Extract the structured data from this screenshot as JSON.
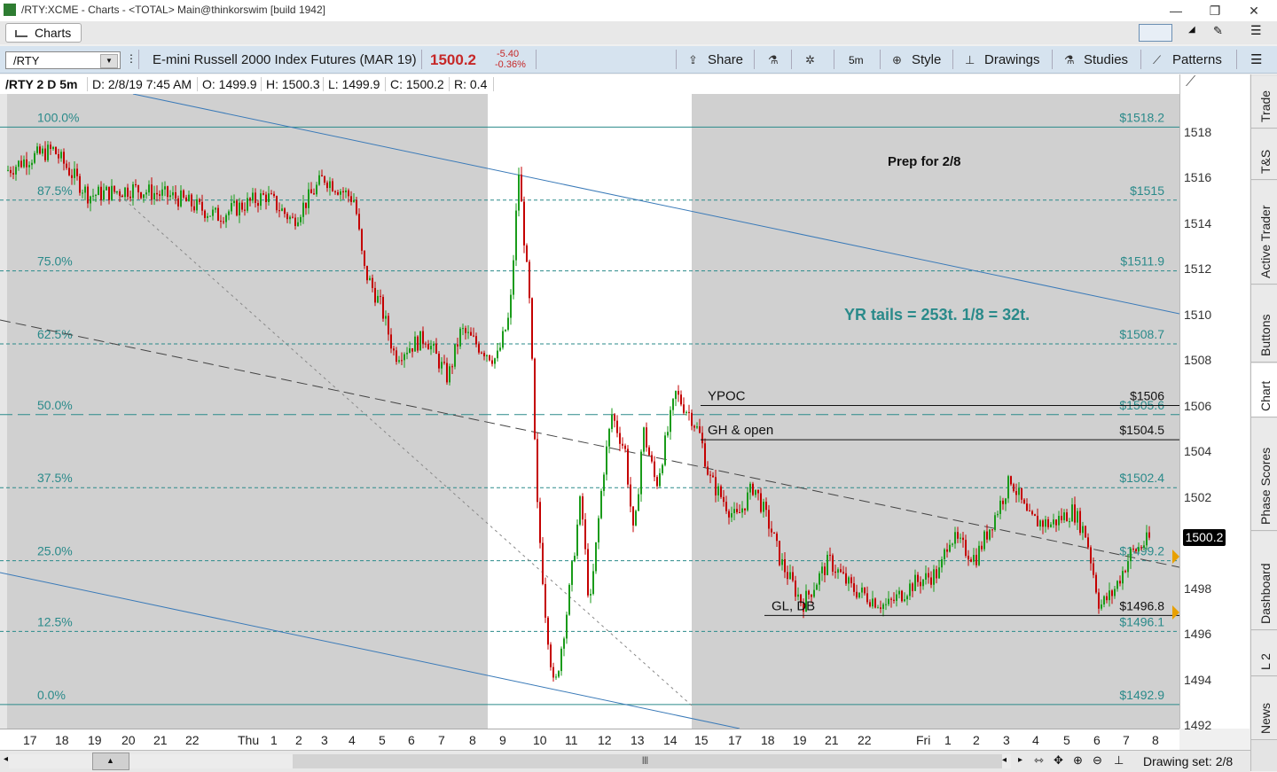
{
  "window": {
    "title": "/RTY:XCME - Charts - <TOTAL> Main@thinkorswim [build 1942]",
    "minimize": "—",
    "restore": "❐",
    "close": "✕"
  },
  "tabs": {
    "charts": "Charts"
  },
  "toolbar": {
    "symbol": "/RTY",
    "description": "E-mini Russell 2000 Index Futures (MAR 19)",
    "last": "1500.2",
    "net_change": "-5.40",
    "pct_change": "-0.36%",
    "share": "Share",
    "timeframe": "5m",
    "style": "Style",
    "drawings": "Drawings",
    "studies": "Studies",
    "patterns": "Patterns"
  },
  "infobar": {
    "label": "/RTY 2 D 5m",
    "date": "D: 2/8/19 7:45 AM",
    "open": "O: 1499.9",
    "high": "H: 1500.3",
    "low": "L: 1499.9",
    "close": "C: 1500.2",
    "range": "R: 0.4"
  },
  "chart": {
    "fib_levels": [
      {
        "pct": "100.0%",
        "price": "$1518.2",
        "value": 1518.2
      },
      {
        "pct": "87.5%",
        "price": "$1515",
        "value": 1515.0
      },
      {
        "pct": "75.0%",
        "price": "$1511.9",
        "value": 1511.9
      },
      {
        "pct": "62.5%",
        "price": "$1508.7",
        "value": 1508.7
      },
      {
        "pct": "50.0%",
        "price": "$1505.6",
        "value": 1505.6
      },
      {
        "pct": "37.5%",
        "price": "$1502.4",
        "value": 1502.4
      },
      {
        "pct": "25.0%",
        "price": "$1499.2",
        "value": 1499.2
      },
      {
        "pct": "12.5%",
        "price": "$1496.1",
        "value": 1496.1
      },
      {
        "pct": "0.0%",
        "price": "$1492.9",
        "value": 1492.9
      }
    ],
    "levels": [
      {
        "label": "YPOC",
        "price": "$1506",
        "value": 1506.0
      },
      {
        "label": "GH & open",
        "price": "$1504.5",
        "value": 1504.5
      },
      {
        "label": "GL, DB",
        "price": "$1496.8",
        "value": 1496.8
      }
    ],
    "note_title": "Prep for 2/8",
    "note_tails": "YR tails = 253t. 1/8 = 32t.",
    "current_price": "1500.2",
    "y_ticks": [
      "1518",
      "1516",
      "1514",
      "1512",
      "1510",
      "1508",
      "1506",
      "1504",
      "1502",
      "1498",
      "1496",
      "1494",
      "1492"
    ],
    "x_ticks": [
      "17",
      "18",
      "19",
      "20",
      "21",
      "22",
      "Thu",
      "1",
      "2",
      "3",
      "4",
      "5",
      "6",
      "7",
      "8",
      "9",
      "10",
      "11",
      "12",
      "13",
      "14",
      "15",
      "17",
      "18",
      "19",
      "21",
      "22",
      "Fri",
      "1",
      "2",
      "3",
      "4",
      "5",
      "6",
      "7",
      "8"
    ]
  },
  "sidebar": [
    "Trade",
    "T&S",
    "Active Trader",
    "Buttons",
    "Chart",
    "Phase Scores",
    "Dashboard",
    "L 2",
    "News"
  ],
  "status": {
    "drawing_set": "Drawing set: 2/8"
  },
  "colors": {
    "up": "#1a9b1a",
    "down": "#c40000",
    "fib": "#2a8a8a",
    "session_shade": "#d0d0d0",
    "channel": "#3a7ab8"
  }
}
